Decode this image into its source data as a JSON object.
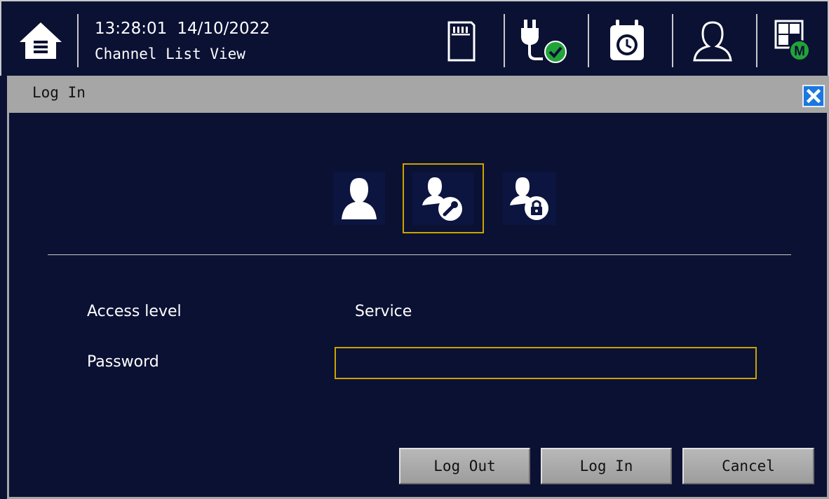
{
  "header": {
    "time": "13:28:01",
    "date": "14/10/2022",
    "view_name": "Channel List View"
  },
  "toolbar_icons": [
    "home-icon",
    "sd-card-icon",
    "power-ok-icon",
    "timer-icon",
    "user-icon",
    "dashboard-master-icon"
  ],
  "dialog": {
    "title": "Log In",
    "roles": [
      {
        "name": "operator-role-icon",
        "selected": false
      },
      {
        "name": "service-role-icon",
        "selected": true
      },
      {
        "name": "admin-lock-role-icon",
        "selected": false
      }
    ],
    "access_level_label": "Access level",
    "access_level_value": "Service",
    "password_label": "Password",
    "password_value": "",
    "buttons": {
      "log_out": "Log Out",
      "log_in": "Log In",
      "cancel": "Cancel"
    }
  },
  "colors": {
    "background": "#0b1133",
    "highlight": "#c9a400",
    "title_bar": "#a6a6a6",
    "close_button": "#1a78e0",
    "status_ok": "#22a33a"
  }
}
